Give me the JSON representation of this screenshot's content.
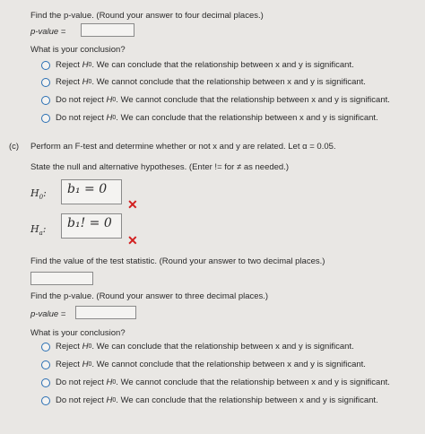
{
  "part_b": {
    "pvalue_prompt": "Find the p-value. (Round your answer to four decimal places.)",
    "pvalue_label": "p-value =",
    "pvalue_value": "",
    "conclusion_prompt": "What is your conclusion?",
    "options": [
      {
        "lead": "Reject",
        "h": "H",
        "sub": "0",
        "rest": ". We can conclude that the relationship between x and y is significant."
      },
      {
        "lead": "Reject",
        "h": "H",
        "sub": "0",
        "rest": ". We cannot conclude that the relationship between x and y is significant."
      },
      {
        "lead": "Do not reject",
        "h": "H",
        "sub": "0",
        "rest": ". We cannot conclude that the relationship between x and y is significant."
      },
      {
        "lead": "Do not reject",
        "h": "H",
        "sub": "0",
        "rest": ". We can conclude that the relationship between x and y is significant."
      }
    ]
  },
  "part_c": {
    "label": "(c)",
    "instruction": "Perform an F-test and determine whether or not x and y are related. Let α = 0.05.",
    "hypotheses_prompt": "State the null and alternative hypotheses. (Enter != for ≠ as needed.)",
    "h0_label": "H",
    "h0_sub": "0",
    "h0_value": "b₁ = 0",
    "ha_label": "H",
    "ha_sub": "a",
    "ha_value": "b₁! = 0",
    "wrong_mark": "✕",
    "test_stat_prompt": "Find the value of the test statistic. (Round your answer to two decimal places.)",
    "test_stat_value": "",
    "pvalue_prompt": "Find the p-value. (Round your answer to three decimal places.)",
    "pvalue_label": "p-value =",
    "pvalue_value": "",
    "conclusion_prompt": "What is your conclusion?",
    "options": [
      {
        "lead": "Reject",
        "h": "H",
        "sub": "0",
        "rest": ". We can conclude that the relationship between x and y is significant."
      },
      {
        "lead": "Reject",
        "h": "H",
        "sub": "0",
        "rest": ". We cannot conclude that the relationship between x and y is significant."
      },
      {
        "lead": "Do not reject",
        "h": "H",
        "sub": "0",
        "rest": ". We cannot conclude that the relationship between x and y is significant."
      },
      {
        "lead": "Do not reject",
        "h": "H",
        "sub": "0",
        "rest": ". We can conclude that the relationship between x and y is significant."
      }
    ]
  }
}
